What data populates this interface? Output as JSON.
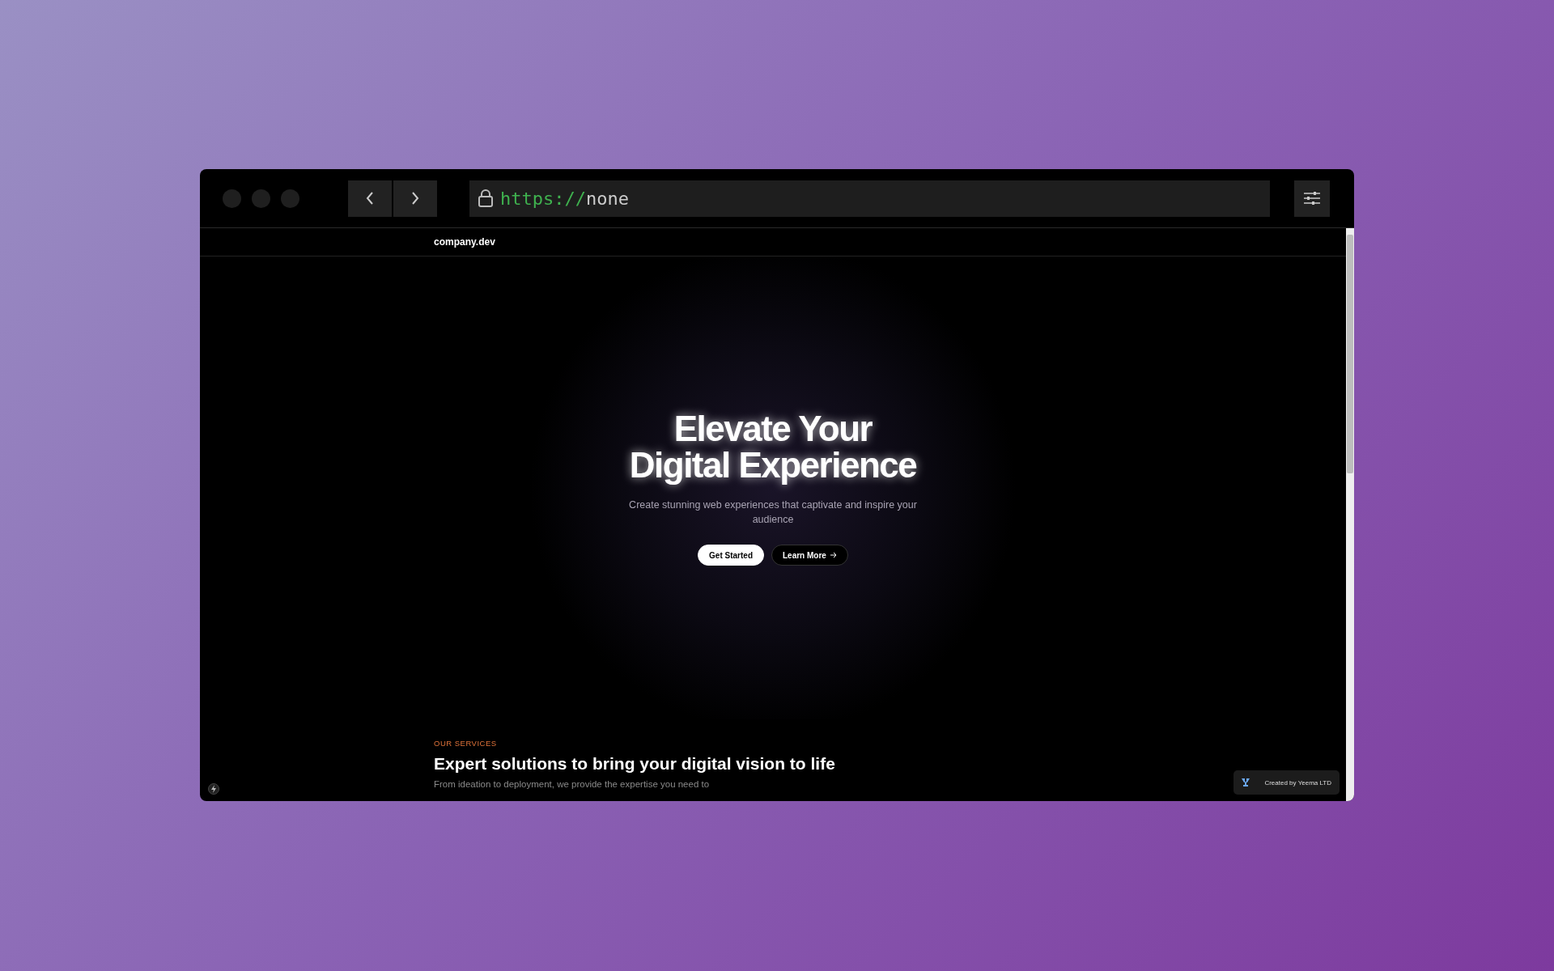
{
  "browser": {
    "url_scheme": "https://",
    "url_host": "none"
  },
  "site": {
    "logo": "company.dev"
  },
  "hero": {
    "title_line_1": "Elevate Your",
    "title_line_2": "Digital Experience",
    "subtitle": "Create stunning web experiences that captivate and inspire your audience",
    "buttons": [
      {
        "label": "Get Started",
        "kind": "primary"
      },
      {
        "label": "Learn More",
        "kind": "secondary"
      }
    ]
  },
  "services": {
    "eyebrow": "OUR SERVICES",
    "heading": "Expert solutions to bring your digital vision to life",
    "description": "From ideation to deployment, we provide the expertise you need to"
  },
  "badge": {
    "label": "Created by Yeema LTD"
  }
}
